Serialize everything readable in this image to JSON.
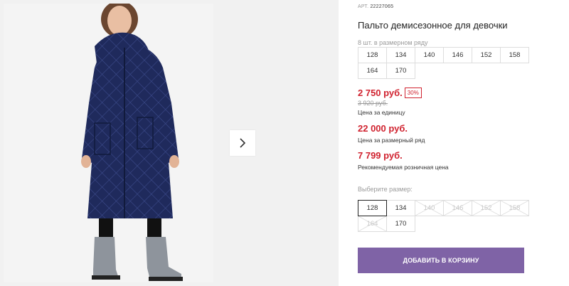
{
  "product": {
    "sku_label": "АРТ.",
    "sku_value": "22227065",
    "title": "Пальто демисезонное для девочки",
    "pack_note": "8 шт. в размерном ряду",
    "pack_sizes": [
      "128",
      "134",
      "140",
      "146",
      "152",
      "158",
      "164",
      "170"
    ],
    "price_unit": "2 750 руб.",
    "discount": "30%",
    "old_price": "3 920 руб.",
    "price_unit_label": "Цена за единицу",
    "price_row": "22 000 руб.",
    "price_row_label": "Цена за размерный ряд",
    "price_retail": "7 799 руб.",
    "price_retail_label": "Рекомендуемая розничная цена",
    "choose_size_label": "Выберите размер:",
    "sizes": [
      {
        "label": "128",
        "state": "selected"
      },
      {
        "label": "134",
        "state": "available"
      },
      {
        "label": "140",
        "state": "unavailable"
      },
      {
        "label": "146",
        "state": "unavailable"
      },
      {
        "label": "152",
        "state": "unavailable"
      },
      {
        "label": "158",
        "state": "unavailable"
      },
      {
        "label": "164",
        "state": "unavailable"
      },
      {
        "label": "170",
        "state": "available"
      }
    ],
    "add_to_cart": "ДОБАВИТЬ В КОРЗИНУ"
  },
  "gallery": {
    "next_icon": "chevron-right-icon"
  },
  "colors": {
    "price_red": "#d0222f",
    "button_purple": "#7f63a6",
    "coat_navy": "#1f2a5c"
  }
}
